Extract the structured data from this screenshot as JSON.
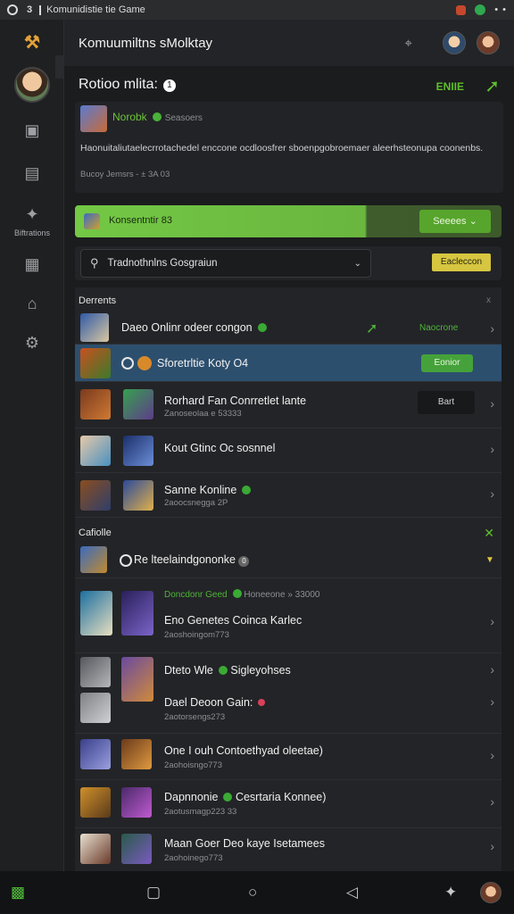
{
  "status_bar": {
    "num": "3",
    "title": "Komunidistie tie Game",
    "dots": "• •"
  },
  "sidebar": {
    "label": "Biftrations"
  },
  "header": {
    "title": "Komuumiltns sMolktay"
  },
  "profile": {
    "title": "Rotioo mlita:",
    "badge": "1",
    "status": "ENIIE",
    "name": "Norobk",
    "section": "Seasoers",
    "description": "Haonuitaliutaelecrrotachedel enccone ocdloosfrer sboenpgobroemaer aleerhsteonupa coonenbs.",
    "meta": "Bucoy Jemsrs - ± 3A 03"
  },
  "banner": {
    "text": "Konsentntir 83",
    "button": "Seeees ⌄"
  },
  "search": {
    "value": "Tradnothnlns Gosgraiun",
    "filter_button": "Eacleccon"
  },
  "sections": {
    "first": "Derrents",
    "first_right": "x",
    "second": "Cafiolle",
    "second_right": "✕"
  },
  "rows": {
    "r1": {
      "label": "Daeo Onlinr odeer congon",
      "right": "Naocrone"
    },
    "r2": {
      "label": "Sforetrltie Koty O4",
      "button": "Eonior"
    },
    "r3": {
      "label": "Rorhard Fan Conrretlet lante",
      "sub": "Zanoseolaa e 53333",
      "button": "Bart"
    },
    "r4": {
      "label": "Kout Gtinc Oc sosnnel"
    },
    "r5": {
      "label": "Sanne Konline",
      "sub": "2aoocsnegga 2P"
    },
    "r6": {
      "label": "Re lteelaindgononke",
      "num": "0"
    },
    "r7": {
      "top": "Doncdonr Geed",
      "top_right": "Honeeone » 33000",
      "label": "Eno Genetes Coinca Karlec",
      "sub": "2aoshoingom773"
    },
    "r8": {
      "label": "Dteto Wle",
      "label2": "Sigleyohses"
    },
    "r9": {
      "label": "Dael Deoon Gain:",
      "sub": "2aotorsengs273"
    },
    "r10": {
      "label": "One I ouh Contoethyad oleetae)",
      "sub": "2aohoisngo773"
    },
    "r11": {
      "label": "Dapnnonie",
      "label2": "Cesrtaria Konnee)",
      "sub": "2aotusmagp223 33"
    },
    "r12": {
      "label": "Maan Goer Deo kaye Isetamees",
      "sub": "2aohoinego773"
    }
  },
  "bottom_nav": {}
}
